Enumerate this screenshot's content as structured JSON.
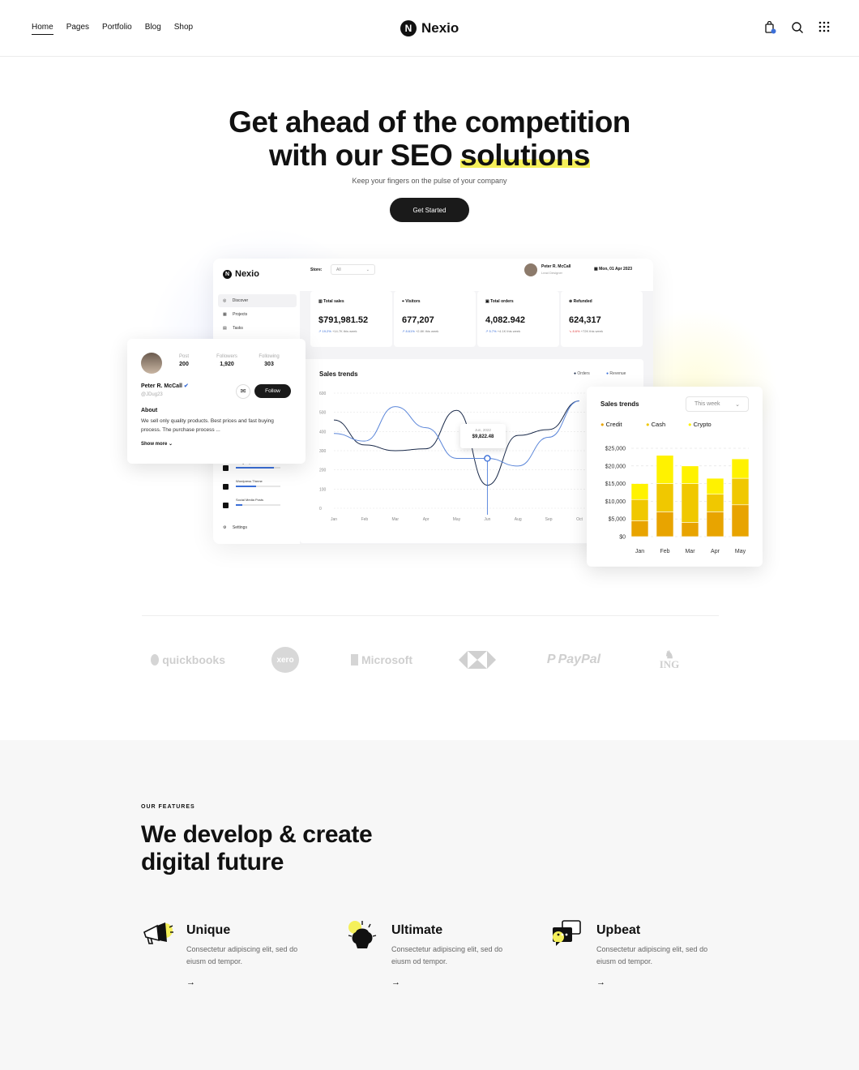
{
  "nav": {
    "items": [
      "Home",
      "Pages",
      "Portfolio",
      "Blog",
      "Shop"
    ]
  },
  "brand": {
    "name": "Nexio",
    "mark": "N"
  },
  "hero": {
    "title_line1": "Get ahead of the competition",
    "title_line2a": "with our SEO ",
    "title_line2b": "solutions",
    "subtitle": "Keep your fingers on the pulse of your company",
    "cta": "Get Started"
  },
  "dashboard": {
    "store_label": "Store:",
    "store_value": "All",
    "user_name": "Peter R. McCall",
    "user_role": "Lead Designer",
    "date": "Mon, 01 Apr 2023",
    "sidebar": [
      "Discover",
      "Projects",
      "Tasks"
    ],
    "projects": [
      {
        "name": "Design System",
        "progress": 0.85
      },
      {
        "name": "Wordpress Theme",
        "progress": 0.45
      },
      {
        "name": "Social Media Posts",
        "progress": 0.15
      }
    ],
    "settings": "Settings",
    "stats": [
      {
        "label": "Total sales",
        "value": "$791,981.52",
        "change": "19.2%",
        "delta": "+14.7K this week",
        "dir": "up"
      },
      {
        "label": "Visitors",
        "value": "677,207",
        "change": "8.61%",
        "delta": "+2.8K this week",
        "dir": "up"
      },
      {
        "label": "Total orders",
        "value": "4,082.942",
        "change": "5.7%",
        "delta": "+4.1K this week",
        "dir": "up"
      },
      {
        "label": "Refunded",
        "value": "624,317",
        "change": "8.6%",
        "delta": "+72K this week",
        "dir": "down"
      }
    ],
    "chart_title": "Sales trends",
    "legend": [
      "Orders",
      "Revenue"
    ],
    "tooltip_date": "Jun, 2022",
    "tooltip_value": "$9,822.48"
  },
  "profile": {
    "post_label": "Post",
    "post": "200",
    "followers_label": "Followers",
    "followers": "1,920",
    "following_label": "Following",
    "following": "303",
    "name": "Peter R. McCall",
    "handle": "@JDug23",
    "follow": "Follow",
    "about_title": "About",
    "about_text": "We sell only quality products. Best prices and fast buying process. The purchase process ...",
    "show_more": "Show more"
  },
  "bars_card": {
    "title": "Sales trends",
    "period": "This week",
    "legend": [
      "Credit",
      "Cash",
      "Crypto"
    ]
  },
  "brands": [
    "quickbooks",
    "xero",
    "Microsoft",
    "HSBC",
    "PayPal",
    "ING"
  ],
  "features": {
    "tag": "OUR FEATURES",
    "title_line1": "We develop & create",
    "title_line2": "digital future",
    "items": [
      {
        "title": "Unique",
        "desc": "Consectetur adipiscing elit, sed do eiusm od tempor.",
        "arrow": "→"
      },
      {
        "title": "Ultimate",
        "desc": "Consectetur adipiscing elit, sed do eiusm od tempor.",
        "arrow": "→"
      },
      {
        "title": "Upbeat",
        "desc": "Consectetur adipiscing elit, sed do eiusm od tempor.",
        "arrow": "→"
      }
    ]
  },
  "colors": {
    "accent": "#f5f05a",
    "dark": "#1a1a1a",
    "blue": "#3b6fd8",
    "credit": "#e8a400",
    "cash": "#f0c800",
    "crypto": "#fff200"
  },
  "chart_data": [
    {
      "type": "line",
      "title": "Sales trends",
      "x": [
        "Jan",
        "Feb",
        "Mar",
        "Apr",
        "May",
        "Jun",
        "Aug",
        "Sep",
        "Oct"
      ],
      "ylim": [
        0,
        600
      ],
      "yticks": [
        0,
        100,
        200,
        300,
        400,
        500,
        600
      ],
      "series": [
        {
          "name": "Orders",
          "values": [
            460,
            330,
            300,
            310,
            510,
            120,
            380,
            410,
            560
          ]
        },
        {
          "name": "Revenue",
          "values": [
            390,
            350,
            530,
            420,
            260,
            260,
            220,
            370,
            560
          ]
        }
      ]
    },
    {
      "type": "bar",
      "title": "Sales trends",
      "categories": [
        "Jan",
        "Feb",
        "Mar",
        "Apr",
        "May"
      ],
      "ylim": [
        0,
        25000
      ],
      "yticks": [
        "$0",
        "$5,000",
        "$10,000",
        "$15,000",
        "$20,000",
        "$25,000"
      ],
      "series": [
        {
          "name": "Credit",
          "values": [
            4500,
            7000,
            4000,
            7000,
            9000
          ]
        },
        {
          "name": "Cash",
          "values": [
            6000,
            8000,
            11000,
            5000,
            7500
          ]
        },
        {
          "name": "Crypto",
          "values": [
            4500,
            8000,
            5000,
            4500,
            5500
          ]
        }
      ]
    }
  ]
}
